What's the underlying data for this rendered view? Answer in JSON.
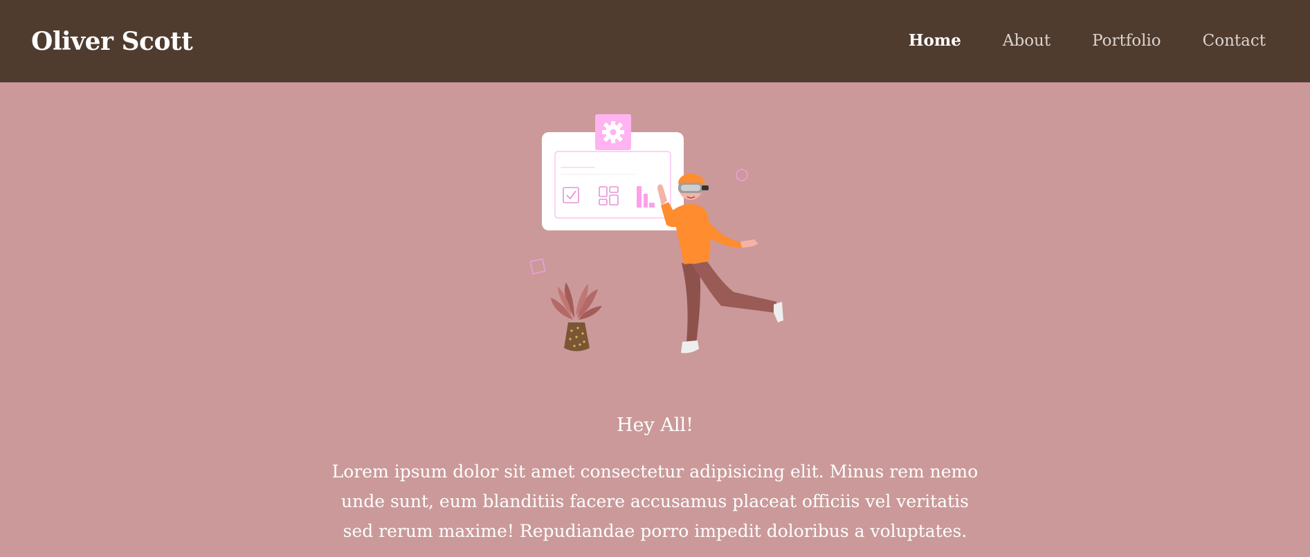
{
  "navbar": {
    "brand": "Oliver Scott",
    "links": [
      {
        "label": "Home",
        "active": true
      },
      {
        "label": "About",
        "active": false
      },
      {
        "label": "Portfolio",
        "active": false
      },
      {
        "label": "Contact",
        "active": false
      }
    ]
  },
  "hero": {
    "illustration": "vr-person-dancing-illustration",
    "greeting": "Hey All!",
    "intro": "Lorem ipsum dolor sit amet consectetur adipisicing elit. Minus rem nemo unde sunt, eum blanditiis facere accusamus placeat officiis vel veritatis sed rerum maxime! Repudiandae porro impedit doloribus a voluptates."
  },
  "colors": {
    "navbar_bg": "#4f3c2f",
    "page_bg": "#cb9999",
    "accent_orange": "#ff8c2f",
    "accent_pink": "#ffb3f0"
  }
}
